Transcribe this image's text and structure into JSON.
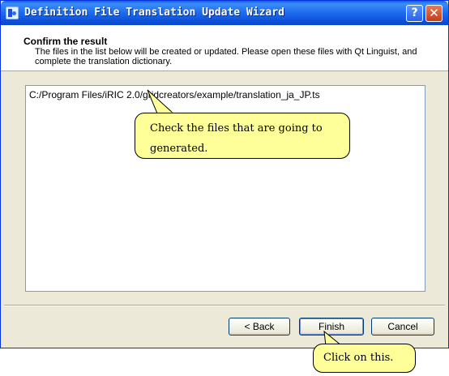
{
  "window": {
    "title": "Definition File Translation Update Wizard",
    "help_label": "?",
    "close_label": "✕"
  },
  "header": {
    "title": "Confirm the result",
    "description": "The files in the list below will be created or updated. Please open these files with Qt Linguist, and complete the translation dictionary."
  },
  "file_list": {
    "items": [
      "C:/Program Files/iRIC 2.0/gridcreators/example/translation_ja_JP.ts"
    ]
  },
  "buttons": {
    "back_label": "< Back",
    "finish_label": "Finish",
    "cancel_label": "Cancel"
  },
  "annotations": {
    "callout_1": "Check the files that are going to generated.",
    "callout_2": "Click on this."
  },
  "colors": {
    "titlebar": "#0a5fe6",
    "dialog_face": "#ece9d8",
    "callout_fill": "#ffff99"
  }
}
